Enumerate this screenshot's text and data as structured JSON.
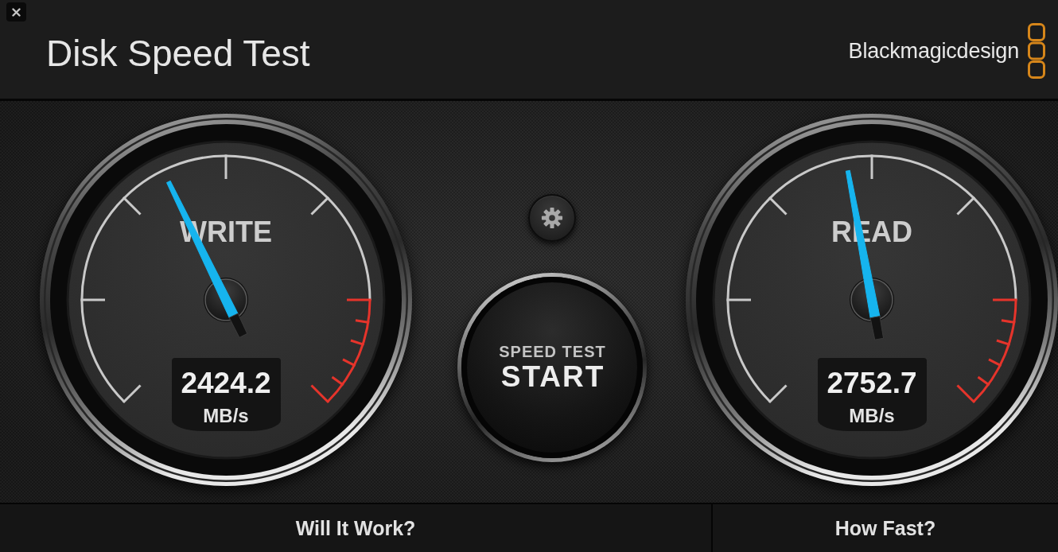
{
  "window": {
    "title": "Disk Speed Test",
    "brand": "Blackmagicdesign"
  },
  "gauges": [
    {
      "label": "WRITE",
      "level": 0.404,
      "value": "2424.2",
      "unit": "MB/s"
    },
    {
      "label": "READ",
      "level": 0.461,
      "value": "2752.7",
      "unit": "MB/s"
    }
  ],
  "start_button": {
    "caption": "SPEED TEST",
    "label": "START"
  },
  "panels": [
    {
      "title": "Will It Work?"
    },
    {
      "title": "How Fast?"
    }
  ]
}
